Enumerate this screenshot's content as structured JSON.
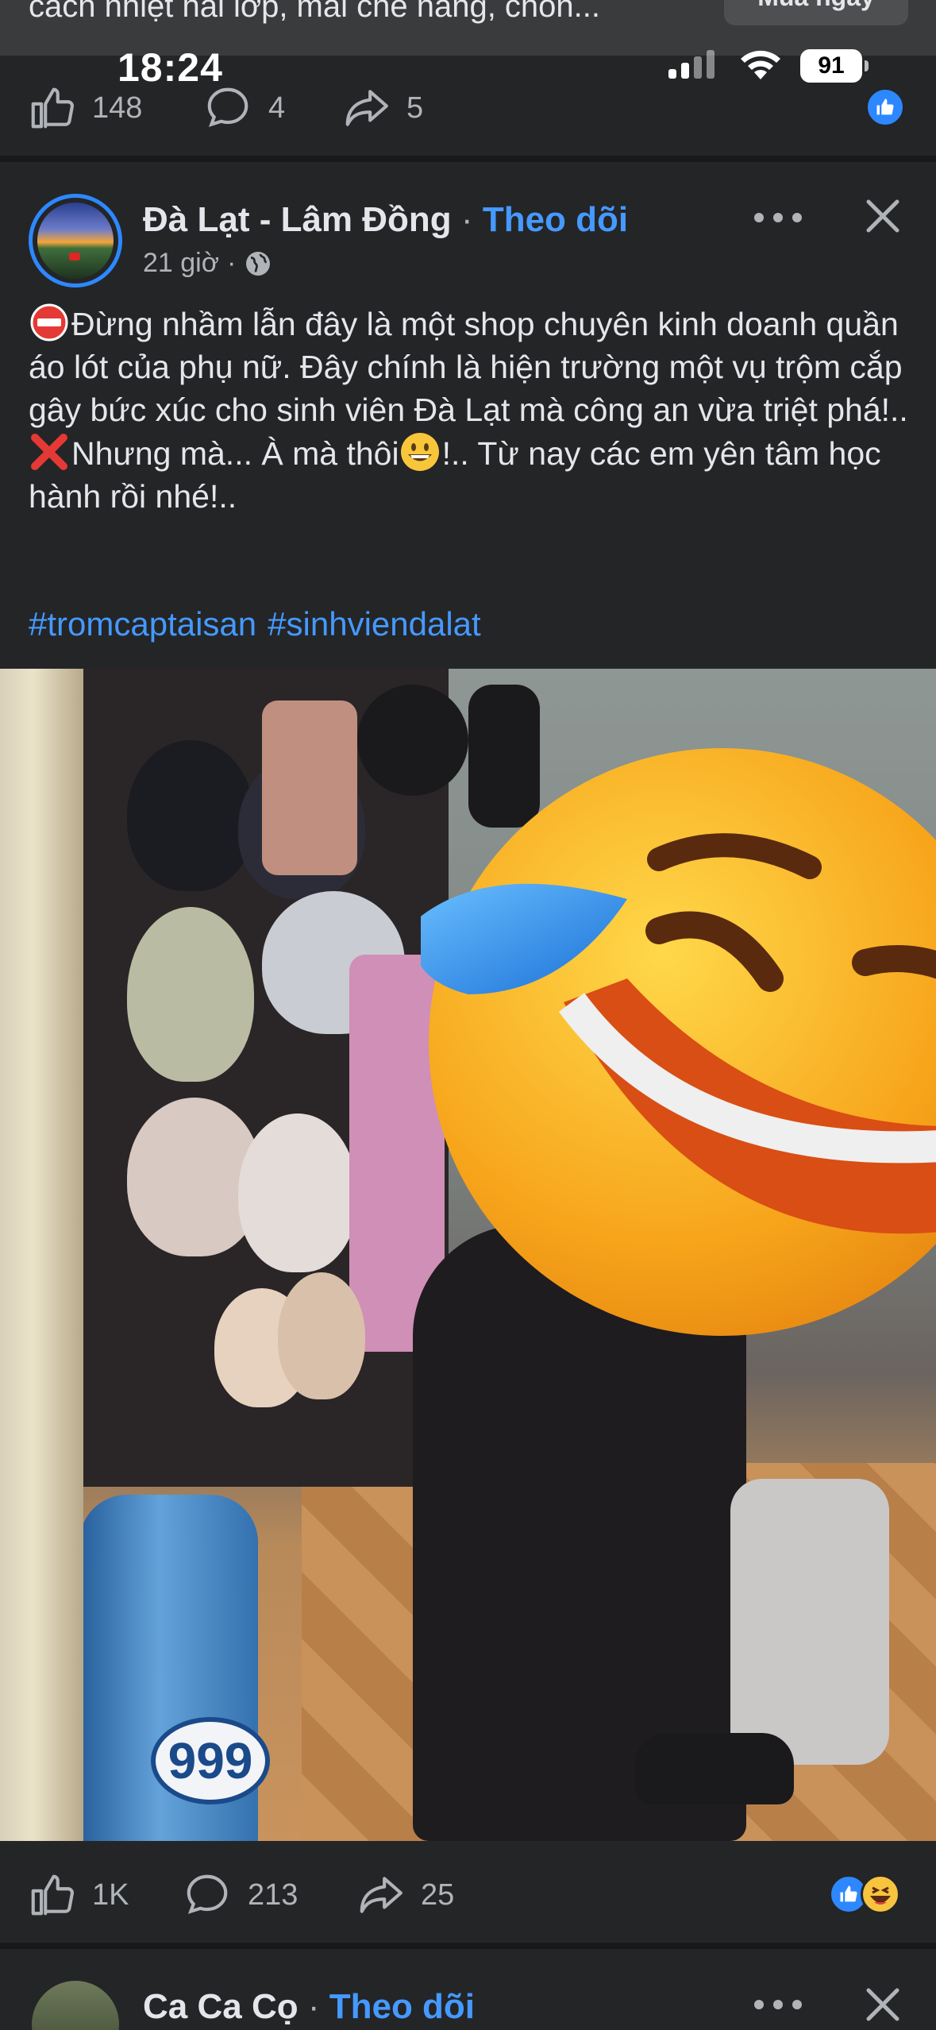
{
  "status_bar": {
    "time": "18:24",
    "battery": "91"
  },
  "previous_post": {
    "link_text": "cách nhiệt hai lớp, mái che nắng, chốn...",
    "link_button": "Mua ngay",
    "likes": "148",
    "comments": "4",
    "shares": "5"
  },
  "post": {
    "page_name": "Đà Lạt - Lâm Đồng",
    "separator": "·",
    "follow": "Theo dõi",
    "time": "21 giờ",
    "meta_sep": "·",
    "line1": "Đừng nhầm lẫn đây là một shop chuyên kinh doanh quần áo lót của phụ nữ. Đây chính là hiện trường một vụ trộm cắp gây bức xúc cho sinh viên Đà Lạt mà công an vừa triệt phá!..",
    "line2_a": "Nhưng mà... À mà thôi",
    "line2_b": "!.. Từ nay các em yên tâm học hành rồi nhé!..",
    "hashtags": [
      "#tromcaptaisan",
      "#sinhviendalat"
    ],
    "photo_jug_text": "999",
    "likes": "1K",
    "comments": "213",
    "shares": "25"
  },
  "next_post": {
    "page_name": "Ca Ca Cọ",
    "separator": "·",
    "follow": "Theo dõi"
  },
  "colors": {
    "accent": "#4599ff",
    "background": "#242527",
    "text": "#e4e6eb",
    "muted": "#b0b3b8"
  },
  "icons": [
    "like-icon",
    "comment-icon",
    "share-icon",
    "more-icon",
    "close-icon",
    "globe-icon",
    "no-entry-icon",
    "cross-mark-icon",
    "grinning-face-icon",
    "tears-of-joy-icon"
  ]
}
